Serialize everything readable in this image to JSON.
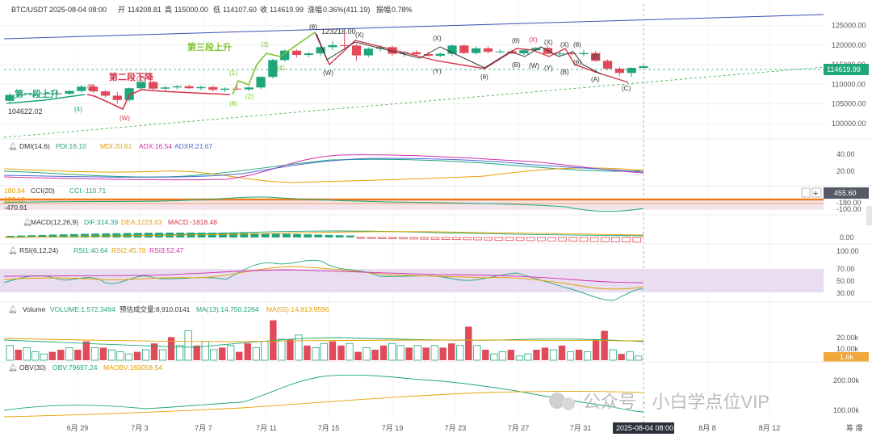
{
  "chart_data": {
    "type": "candlestick",
    "header": {
      "symbol": "BTC/USDT",
      "datetime": "2025-08-04 08:00",
      "open_label": "开",
      "open": "114208.81",
      "high_label": "高",
      "high": "115000.00",
      "low_label": "低",
      "low": "114107.60",
      "close_label": "收",
      "close": "114619.99",
      "change_label": "涨幅",
      "change": "0.36%(411.19)",
      "amp_label": "振幅",
      "amp": "0.78%"
    },
    "price_axis": {
      "ticks": [
        "125000.00",
        "120000.00",
        "115000.00",
        "110000.00",
        "105000.00",
        "100000.00"
      ],
      "last_price": "114619.99",
      "range": [
        97500,
        127000
      ]
    },
    "x_axis": {
      "ticks": [
        "6月 29",
        "7月 3",
        "7月 7",
        "7月 11",
        "7月 15",
        "7月 19",
        "7月 23",
        "7月 27",
        "7月 31",
        "8月 8",
        "8月 12"
      ],
      "current": "2025-08-04 08:00"
    },
    "candles": [
      {
        "o": 105800,
        "h": 107800,
        "l": 105500,
        "c": 107300
      },
      {
        "o": 107300,
        "h": 107900,
        "l": 107000,
        "c": 107400
      },
      {
        "o": 107400,
        "h": 107800,
        "l": 106800,
        "c": 107500
      },
      {
        "o": 107500,
        "h": 108100,
        "l": 107200,
        "c": 107700
      },
      {
        "o": 107700,
        "h": 108400,
        "l": 107300,
        "c": 107600
      },
      {
        "o": 107600,
        "h": 108500,
        "l": 107200,
        "c": 108300
      },
      {
        "o": 108300,
        "h": 109800,
        "l": 107900,
        "c": 109400
      },
      {
        "o": 109400,
        "h": 109900,
        "l": 107800,
        "c": 108200
      },
      {
        "o": 108200,
        "h": 108600,
        "l": 106700,
        "c": 107100
      },
      {
        "o": 107100,
        "h": 108000,
        "l": 105100,
        "c": 106000
      },
      {
        "o": 106000,
        "h": 109200,
        "l": 105600,
        "c": 109000
      },
      {
        "o": 109000,
        "h": 111000,
        "l": 108800,
        "c": 110600
      },
      {
        "o": 110600,
        "h": 110900,
        "l": 108400,
        "c": 108900
      },
      {
        "o": 108900,
        "h": 109600,
        "l": 108400,
        "c": 109200
      },
      {
        "o": 109200,
        "h": 109800,
        "l": 108600,
        "c": 109500
      },
      {
        "o": 109500,
        "h": 109900,
        "l": 108800,
        "c": 109000
      },
      {
        "o": 109000,
        "h": 109700,
        "l": 108500,
        "c": 109300
      },
      {
        "o": 109300,
        "h": 109700,
        "l": 108200,
        "c": 108600
      },
      {
        "o": 108600,
        "h": 109200,
        "l": 108000,
        "c": 108900
      },
      {
        "o": 108900,
        "h": 109600,
        "l": 108400,
        "c": 108700
      },
      {
        "o": 108700,
        "h": 109500,
        "l": 108300,
        "c": 109200
      },
      {
        "o": 109200,
        "h": 112000,
        "l": 108800,
        "c": 111900
      },
      {
        "o": 111900,
        "h": 116500,
        "l": 111500,
        "c": 116200
      },
      {
        "o": 116200,
        "h": 118900,
        "l": 115800,
        "c": 118600
      },
      {
        "o": 118600,
        "h": 119000,
        "l": 116800,
        "c": 117500
      },
      {
        "o": 117500,
        "h": 118300,
        "l": 116900,
        "c": 117900
      },
      {
        "o": 117900,
        "h": 119800,
        "l": 117400,
        "c": 119500
      },
      {
        "o": 119500,
        "h": 121000,
        "l": 118800,
        "c": 120000
      },
      {
        "o": 120000,
        "h": 123218,
        "l": 119300,
        "c": 119900
      },
      {
        "o": 119900,
        "h": 120300,
        "l": 116000,
        "c": 117400
      },
      {
        "o": 117400,
        "h": 119500,
        "l": 116900,
        "c": 119100
      },
      {
        "o": 119100,
        "h": 120000,
        "l": 118300,
        "c": 119500
      },
      {
        "o": 119500,
        "h": 119900,
        "l": 117300,
        "c": 117800
      },
      {
        "o": 117800,
        "h": 118500,
        "l": 117000,
        "c": 118200
      },
      {
        "o": 118200,
        "h": 118700,
        "l": 117200,
        "c": 117700
      },
      {
        "o": 117700,
        "h": 118300,
        "l": 117100,
        "c": 117300
      },
      {
        "o": 117300,
        "h": 118200,
        "l": 116900,
        "c": 117800
      },
      {
        "o": 117800,
        "h": 120200,
        "l": 117200,
        "c": 119900
      },
      {
        "o": 119900,
        "h": 120200,
        "l": 117700,
        "c": 118000
      },
      {
        "o": 118000,
        "h": 119700,
        "l": 117600,
        "c": 119200
      },
      {
        "o": 119200,
        "h": 119700,
        "l": 117800,
        "c": 118300
      },
      {
        "o": 118300,
        "h": 118900,
        "l": 117900,
        "c": 118400
      },
      {
        "o": 118400,
        "h": 118900,
        "l": 117700,
        "c": 117900
      },
      {
        "o": 117900,
        "h": 118900,
        "l": 117500,
        "c": 118700
      },
      {
        "o": 118700,
        "h": 119500,
        "l": 118300,
        "c": 119300
      },
      {
        "o": 119300,
        "h": 119800,
        "l": 117600,
        "c": 117800
      },
      {
        "o": 117800,
        "h": 118400,
        "l": 117300,
        "c": 117900
      },
      {
        "o": 117900,
        "h": 118500,
        "l": 117400,
        "c": 117700
      },
      {
        "o": 117700,
        "h": 118800,
        "l": 117200,
        "c": 118000
      },
      {
        "o": 118000,
        "h": 118500,
        "l": 115800,
        "c": 116000
      },
      {
        "o": 116000,
        "h": 116400,
        "l": 113700,
        "c": 114000
      },
      {
        "o": 114000,
        "h": 114500,
        "l": 112100,
        "c": 112900
      },
      {
        "o": 112900,
        "h": 114300,
        "l": 111900,
        "c": 114200
      },
      {
        "o": 114200,
        "h": 115000,
        "l": 114100,
        "c": 114620
      }
    ],
    "labels": {
      "wave1": "第一段上升",
      "wave2": "第二段下降",
      "wave3": "第三段上升",
      "low_value": "104622.02",
      "high_value": "123218.00",
      "w_4": "(4)",
      "w_1": "(1)",
      "w_2": "(2)",
      "w_3": "(3)",
      "w_4b": "(4)",
      "w_5": "(5)",
      "w_theta": "(θ)",
      "w_W": "(W)",
      "w_X": "(X)",
      "w_Y": "(Y)",
      "w_B": "(B)",
      "w_A": "(A)",
      "w_C": "(C)"
    },
    "indicators": {
      "dmi": {
        "title": "DMI(14,6)",
        "pdi": "PDI:16.10",
        "mdi": "MDI:20.61",
        "adx": "ADX:16.54",
        "adxr": "ADXR:21.67",
        "ticks": [
          "40.00",
          "20.00"
        ]
      },
      "cci": {
        "title": "CCI(20)",
        "value": "CCI:-110.71",
        "left_top": "180.64",
        "left_mid": "123.12",
        "left_bot": "-470.91",
        "right_box": "455.60",
        "right_t1": "-180.00",
        "right_t2": "-100.00"
      },
      "macd": {
        "title": "MACD(12,26,9)",
        "dif": "DIF:314.39",
        "dea": "DEA:1223.63",
        "macd": "MACD:-1818.48",
        "ticks": [
          "0.00"
        ]
      },
      "rsi": {
        "title": "RSI(6,12,24)",
        "rsi1": "RSI1:40.64",
        "rsi2": "RSI2:45.78",
        "rsi3": "RSI3:52.47",
        "ticks": [
          "100.00",
          "70.00",
          "50.00",
          "30.00"
        ]
      },
      "volume": {
        "title": "Volume",
        "volume": "VOLUME:1,572.3494",
        "est": "预估成交量:8,910.0141",
        "ma13": "MA(13):14,750.2264",
        "ma55": "MA(55):14,813.9596",
        "ticks": [
          "20.00k",
          "10.00k"
        ],
        "box": "1.6k",
        "bars": [
          7,
          5,
          6,
          4,
          3,
          4,
          5,
          6,
          5,
          9,
          6,
          6,
          5,
          4,
          3,
          4,
          5,
          8,
          5,
          11,
          7,
          14,
          7,
          9,
          5,
          6,
          7,
          4,
          8,
          6,
          9,
          19,
          10,
          10,
          12,
          7,
          6,
          8,
          9,
          7,
          8,
          4,
          6,
          5,
          7,
          8,
          7,
          6,
          7,
          6,
          7,
          6,
          8,
          7,
          16,
          7,
          5,
          3,
          4,
          5,
          2,
          3,
          5,
          6,
          5,
          7,
          4,
          5,
          4,
          10,
          14,
          5,
          3,
          4,
          2
        ],
        "up": [
          1,
          0,
          1,
          1,
          1,
          0,
          0,
          1,
          0,
          0,
          1,
          0,
          1,
          1,
          1,
          0,
          1,
          0,
          1,
          0,
          1,
          1,
          0,
          1,
          1,
          0,
          1,
          0,
          0,
          1,
          1,
          0,
          1,
          0,
          1,
          0,
          1,
          1,
          0,
          0,
          1,
          0,
          1,
          0,
          0,
          1,
          1,
          0,
          1,
          0,
          1,
          0,
          0,
          1,
          0,
          1,
          0,
          1,
          1,
          0,
          1,
          1,
          0,
          0,
          1,
          0,
          1,
          0,
          1,
          0,
          0,
          1,
          0,
          1,
          1
        ]
      },
      "obv": {
        "title": "OBV(30)",
        "obv": "OBV:79697.24",
        "maobv": "MAOBV:160058.54",
        "ticks": [
          "200.00k",
          "100.00k"
        ]
      }
    },
    "watermark": "公众号 · 小白学点位VIP",
    "corner": "筹 爆"
  }
}
